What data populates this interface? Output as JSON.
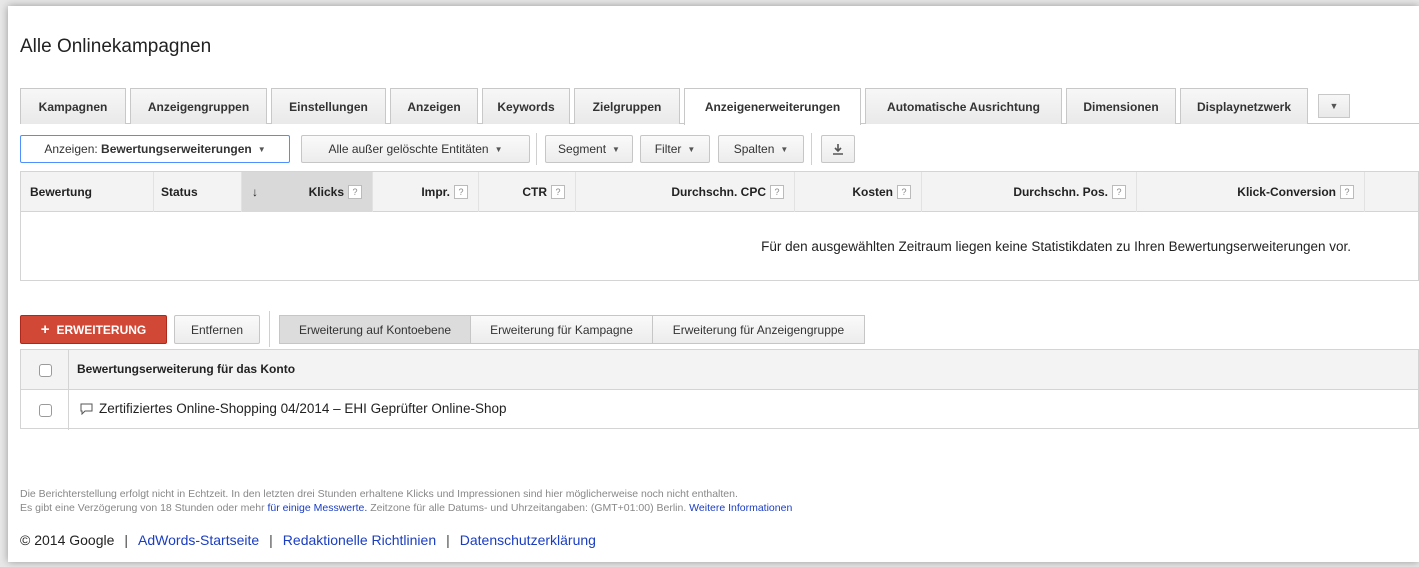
{
  "page_title": "Alle Onlinekampagnen",
  "tabs": [
    {
      "label": "Kampagnen"
    },
    {
      "label": "Anzeigengruppen"
    },
    {
      "label": "Einstellungen"
    },
    {
      "label": "Anzeigen"
    },
    {
      "label": "Keywords"
    },
    {
      "label": "Zielgruppen"
    },
    {
      "label": "Anzeigenerweiterungen",
      "active": true
    },
    {
      "label": "Automatische Ausrichtung"
    },
    {
      "label": "Dimensionen"
    },
    {
      "label": "Displaynetzwerk"
    }
  ],
  "toolbar": {
    "show_prefix": "Anzeigen: ",
    "show_value": "Bewertungserweiterungen",
    "filter_entities": "Alle außer gelöschte Entitäten",
    "segment": "Segment",
    "filter": "Filter",
    "columns": "Spalten"
  },
  "stats_table": {
    "columns": [
      "Bewertung",
      "Status",
      "Klicks",
      "Impr.",
      "CTR",
      "Durchschn. CPC",
      "Kosten",
      "Durchschn. Pos.",
      "Klick-Conversion"
    ],
    "help_glyph": "?",
    "sort_arrow": "↓",
    "empty_message": "Für den ausgewählten Zeitraum liegen keine Statistikdaten zu Ihren Bewertungserweiterungen vor."
  },
  "actions": {
    "add_label": "ERWEITERUNG",
    "add_plus": "+",
    "remove_label": "Entfernen",
    "segments": [
      "Erweiterung auf Kontoebene",
      "Erweiterung für Kampagne",
      "Erweiterung für Anzeigengruppe"
    ]
  },
  "extensions_table": {
    "header": "Bewertungserweiterung für das Konto",
    "rows": [
      {
        "text": "Zertifiziertes Online-Shopping 04/2014 – EHI Geprüfter Online-Shop"
      }
    ]
  },
  "footer": {
    "note_line1": "Die Berichterstellung erfolgt nicht in Echtzeit. In den letzten drei Stunden erhaltene Klicks und Impressionen sind hier möglicherweise noch nicht enthalten.",
    "note_line2_a": "Es gibt eine Verzögerung von 18 Stunden oder mehr ",
    "note_line2_link1": "für einige Messwerte.",
    "note_line2_b": " Zeitzone für alle Datums- und Uhrzeitangaben: (GMT+01:00) Berlin. ",
    "note_line2_link2": "Weitere Informationen",
    "copyright": "© 2014 Google",
    "links": [
      "AdWords-Startseite",
      "Redaktionelle Richtlinien",
      "Datenschutzerklärung"
    ]
  },
  "colors": {
    "add_button": "#d14836",
    "link": "#1a3dc1",
    "active_outline": "#4d90fe"
  }
}
